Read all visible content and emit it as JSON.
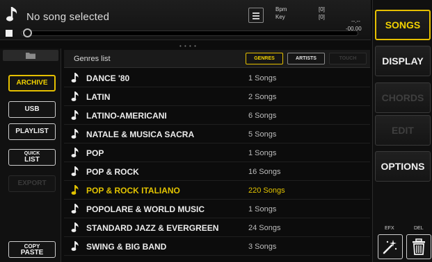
{
  "player": {
    "song_title": "No song selected",
    "bpm_label": "Bpm",
    "key_label": "Key",
    "bpm_value": "[0]",
    "key_value": "[0]",
    "time_top": "--.--",
    "time_bottom": "-00.00"
  },
  "browser": {
    "title": "Genres list",
    "tabs": [
      {
        "label": "GENRES",
        "state": "active"
      },
      {
        "label": "ARTISTS",
        "state": "normal"
      },
      {
        "label": "TOUCH",
        "state": "disabled"
      }
    ],
    "rows": [
      {
        "name": "DANCE '80",
        "count": "1 Songs",
        "selected": false
      },
      {
        "name": "LATIN",
        "count": "2 Songs",
        "selected": false
      },
      {
        "name": "LATINO-AMERICANI",
        "count": "6 Songs",
        "selected": false
      },
      {
        "name": "NATALE & MUSICA SACRA",
        "count": "5 Songs",
        "selected": false
      },
      {
        "name": "POP",
        "count": "1 Songs",
        "selected": false
      },
      {
        "name": "POP & ROCK",
        "count": "16 Songs",
        "selected": false
      },
      {
        "name": "POP & ROCK ITALIANO",
        "count": "220 Songs",
        "selected": true
      },
      {
        "name": "POPOLARE & WORLD MUSIC",
        "count": "1 Songs",
        "selected": false
      },
      {
        "name": "STANDARD JAZZ & EVERGREEN",
        "count": "24 Songs",
        "selected": false
      },
      {
        "name": "SWING & BIG BAND",
        "count": "3 Songs",
        "selected": false
      }
    ]
  },
  "sidebar": {
    "archive": "ARCHIVE",
    "usb": "USB",
    "playlist": "PLAYLIST",
    "quick_list_1": "QUICK",
    "quick_list_2": "LIST",
    "export": "EXPORT",
    "copy_paste_1": "COPY",
    "copy_paste_2": "PASTE"
  },
  "right_menu": {
    "songs": "SONGS",
    "display": "DISPLAY",
    "chords": "CHORDS",
    "edit": "EDIT",
    "options": "OPTIONS",
    "efx_label": "EFX",
    "del_label": "DEL"
  },
  "colors": {
    "accent": "#e6c000",
    "background": "#0c0c0c",
    "disabled_text": "#3f3f3f"
  },
  "icons": {
    "song": "music-note-icon",
    "folder": "folder-icon",
    "list": "list-icon",
    "efx": "magic-wand-icon",
    "del": "trash-icon"
  }
}
